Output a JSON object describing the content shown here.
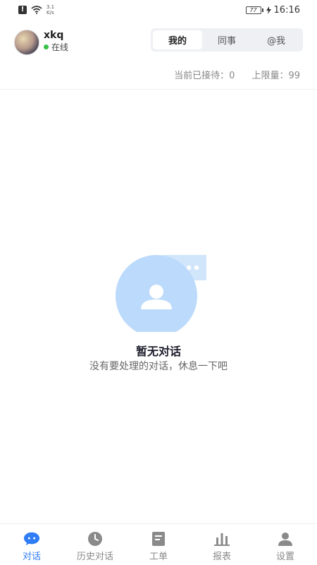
{
  "status_bar": {
    "speed_value": "3.1",
    "speed_unit": "K/s",
    "battery": "77",
    "time": "16:16"
  },
  "header": {
    "username": "xkq",
    "status_text": "在线",
    "tabs": [
      {
        "label": "我的",
        "active": true
      },
      {
        "label": "同事",
        "active": false
      },
      {
        "label": "@我",
        "active": false
      }
    ]
  },
  "quota": {
    "current": "当前已接待：0",
    "limit": "上限量：99"
  },
  "empty_state": {
    "title": "暂无对话",
    "subtitle": "没有要处理的对话，休息一下吧"
  },
  "tab_bar": {
    "items": [
      {
        "label": "对话",
        "icon": "chat-bubble-icon",
        "active": true
      },
      {
        "label": "历史对话",
        "icon": "clock-icon",
        "active": false
      },
      {
        "label": "工单",
        "icon": "document-icon",
        "active": false
      },
      {
        "label": "报表",
        "icon": "bar-chart-icon",
        "active": false
      },
      {
        "label": "设置",
        "icon": "person-icon",
        "active": false
      }
    ]
  },
  "colors": {
    "accent": "#2f7cf6",
    "online": "#38c24a",
    "illustration_circle": "#bcdafb",
    "illustration_bubble": "#d2e6fb"
  }
}
